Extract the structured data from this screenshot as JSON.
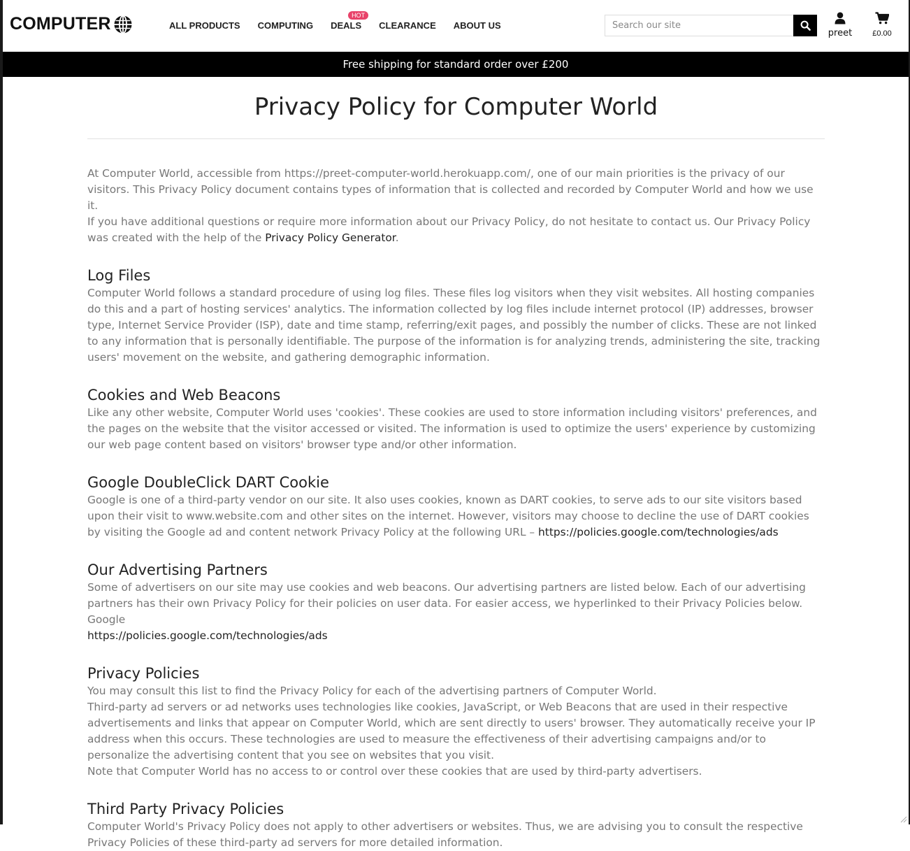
{
  "header": {
    "logo_text": "COMPUTER",
    "nav": [
      {
        "label": "ALL PRODUCTS"
      },
      {
        "label": "COMPUTING"
      },
      {
        "label": "DEALS",
        "badge": "HOT"
      },
      {
        "label": "CLEARANCE"
      },
      {
        "label": "ABOUT US"
      }
    ],
    "search_placeholder": "Search our site",
    "user_label": "preet",
    "cart_total": "£0.00",
    "icons": {
      "logo": "globe-icon",
      "search": "search-icon",
      "user": "user-icon",
      "cart": "cart-icon"
    }
  },
  "banner": {
    "text": "Free shipping for standard order over £200"
  },
  "colors": {
    "badge": "#e8436a",
    "banner_bg": "#000000",
    "body_text": "#777777",
    "heading": "#222222"
  },
  "page": {
    "title": "Privacy Policy for Computer World",
    "intro": {
      "p1": "At Computer World, accessible from https://preet-computer-world.herokuapp.com/, one of our main priorities is the privacy of our visitors. This Privacy Policy document contains types of information that is collected and recorded by Computer World and how we use it.",
      "p2_before": "If you have additional questions or require more information about our Privacy Policy, do not hesitate to contact us. Our Privacy Policy was created with the help of the ",
      "p2_link": "Privacy Policy Generator",
      "p2_after": "."
    },
    "log_files": {
      "heading": "Log Files",
      "text": "Computer World follows a standard procedure of using log files. These files log visitors when they visit websites. All hosting companies do this and a part of hosting services' analytics. The information collected by log files include internet protocol (IP) addresses, browser type, Internet Service Provider (ISP), date and time stamp, referring/exit pages, and possibly the number of clicks. These are not linked to any information that is personally identifiable. The purpose of the information is for analyzing trends, administering the site, tracking users' movement on the website, and gathering demographic information."
    },
    "cookies": {
      "heading": "Cookies and Web Beacons",
      "text": "Like any other website, Computer World uses 'cookies'. These cookies are used to store information including visitors' preferences, and the pages on the website that the visitor accessed or visited. The information is used to optimize the users' experience by customizing our web page content based on visitors' browser type and/or other information."
    },
    "dart": {
      "heading": "Google DoubleClick DART Cookie",
      "text": "Google is one of a third-party vendor on our site. It also uses cookies, known as DART cookies, to serve ads to our site visitors based upon their visit to www.website.com and other sites on the internet. However, visitors may choose to decline the use of DART cookies by visiting the Google ad and content network Privacy Policy at the following URL – ",
      "link": "https://policies.google.com/technologies/ads"
    },
    "partners": {
      "heading": "Our Advertising Partners",
      "text": "Some of advertisers on our site may use cookies and web beacons. Our advertising partners are listed below. Each of our advertising partners has their own Privacy Policy for their policies on user data. For easier access, we hyperlinked to their Privacy Policies below.",
      "partner_name": "Google",
      "partner_link": "https://policies.google.com/technologies/ads"
    },
    "privacy_policies": {
      "heading": "Privacy Policies",
      "p1": "You may consult this list to find the Privacy Policy for each of the advertising partners of Computer World.",
      "p2": "Third-party ad servers or ad networks uses technologies like cookies, JavaScript, or Web Beacons that are used in their respective advertisements and links that appear on Computer World, which are sent directly to users' browser. They automatically receive your IP address when this occurs. These technologies are used to measure the effectiveness of their advertising campaigns and/or to personalize the advertising content that you see on websites that you visit.",
      "p3": "Note that Computer World has no access to or control over these cookies that are used by third-party advertisers."
    },
    "third_party": {
      "heading": "Third Party Privacy Policies",
      "text": "Computer World's Privacy Policy does not apply to other advertisers or websites. Thus, we are advising you to consult the respective Privacy Policies of these third-party ad servers for more detailed information."
    }
  }
}
